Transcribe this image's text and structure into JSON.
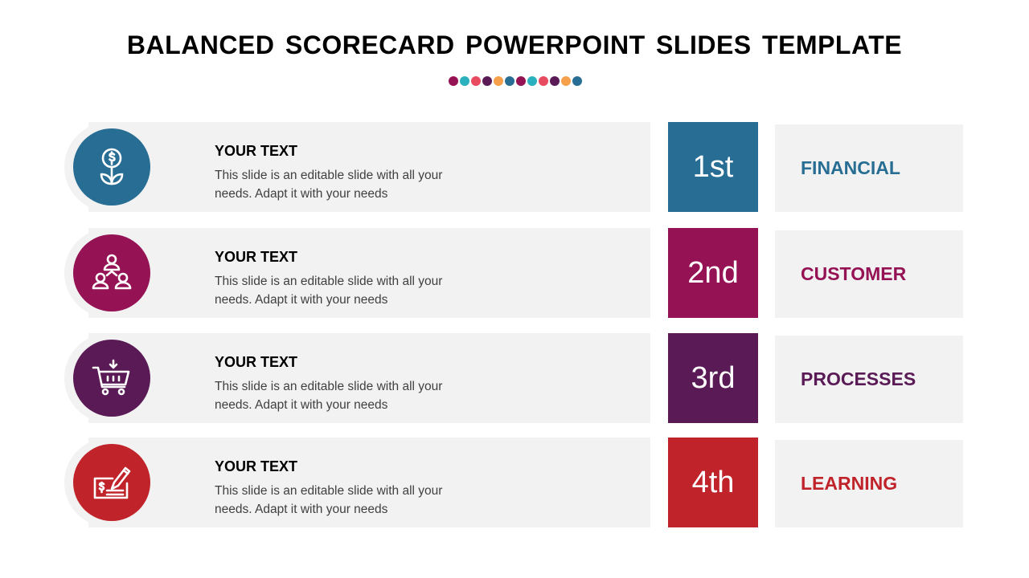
{
  "title": "BALANCED SCORECARD POWERPOINT SLIDES TEMPLATE",
  "dot_colors": [
    "#951354",
    "#2bb0be",
    "#e84a5f",
    "#5a1a56",
    "#f7a04c",
    "#286e94",
    "#951354",
    "#2bb0be",
    "#e84a5f",
    "#5a1a56",
    "#f7a04c",
    "#286e94"
  ],
  "rows": [
    {
      "heading": "YOUR TEXT",
      "description": "This slide is an editable slide with all your needs. Adapt it with your needs",
      "rank": "1st",
      "label": "FINANCIAL",
      "color": "#286e94",
      "icon": "money-plant-icon"
    },
    {
      "heading": "YOUR TEXT",
      "description": "This slide is an editable slide with all your needs. Adapt it with your needs",
      "rank": "2nd",
      "label": "CUSTOMER",
      "color": "#951354",
      "icon": "customer-network-icon"
    },
    {
      "heading": "YOUR TEXT",
      "description": "This slide is an editable slide with all your needs. Adapt it with your needs",
      "rank": "3rd",
      "label": "PROCESSES",
      "color": "#5a1a56",
      "icon": "shopping-cart-icon"
    },
    {
      "heading": "YOUR TEXT",
      "description": "This slide is an editable slide with all your needs. Adapt it with your needs",
      "rank": "4th",
      "label": "LEARNING",
      "color": "#c0242a",
      "icon": "cheque-pen-icon"
    }
  ]
}
